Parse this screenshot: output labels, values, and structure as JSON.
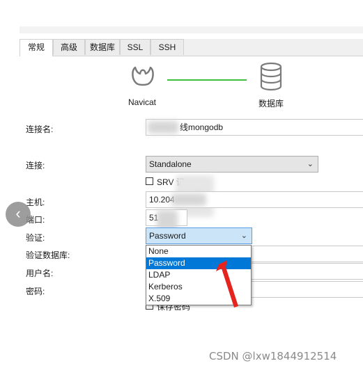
{
  "tabs": [
    {
      "label": "常规",
      "active": true
    },
    {
      "label": "高级",
      "active": false
    },
    {
      "label": "数据库",
      "active": false
    },
    {
      "label": "SSL",
      "active": false
    },
    {
      "label": "SSH",
      "active": false
    }
  ],
  "diagram": {
    "left_caption": "Navicat",
    "right_caption": "数据库",
    "line_color": "#3cbf3c"
  },
  "form": {
    "conn_name_label": "连接名:",
    "conn_name_value": "线mongodb",
    "connection_label": "连接:",
    "connection_value": "Standalone",
    "srv_label": "SRV 记",
    "host_label": "主机:",
    "host_value": "10.204",
    "port_label": "端口:",
    "port_value": "51",
    "auth_label": "验证:",
    "auth_value": "Password",
    "auth_db_label": "验证数据库:",
    "username_label": "用户名:",
    "password_label": "密码:",
    "save_password_label": "保存密码"
  },
  "auth_options": [
    "None",
    "Password",
    "LDAP",
    "Kerberos",
    "X.509"
  ],
  "auth_selected_index": 1,
  "accent_color": "#0078d7",
  "watermark": "CSDN @lxw1844912514"
}
